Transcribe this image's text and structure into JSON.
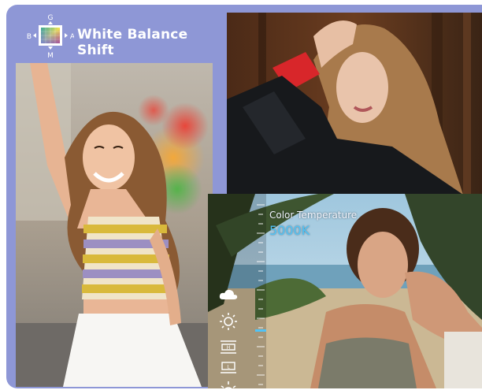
{
  "header": {
    "title": "White Balance Shift",
    "axis_top": "G",
    "axis_bottom": "M",
    "axis_left": "B",
    "axis_right": "A"
  },
  "camera_overlay": {
    "ct_label": "Color Temperature",
    "ct_value": "5000K",
    "ct_value_color": "#4fc3f7",
    "icons": [
      "cloud-icon",
      "sun-icon",
      "fluorescent-icon",
      "incandescent-icon",
      "sunrise-icon"
    ],
    "badges": [
      "H",
      "L"
    ]
  },
  "colors": {
    "frame": "#8e97d6",
    "title": "#ffffff"
  }
}
